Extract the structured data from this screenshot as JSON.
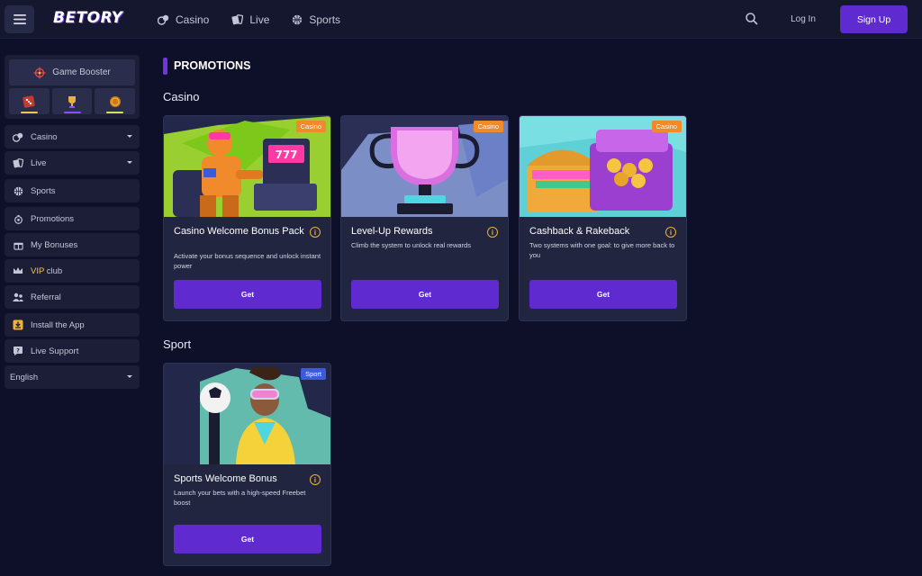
{
  "header": {
    "logo": "BETORY",
    "nav": [
      {
        "label": "Casino",
        "icon": "casino-chips-icon"
      },
      {
        "label": "Live",
        "icon": "live-cards-icon"
      },
      {
        "label": "Sports",
        "icon": "basketball-icon"
      }
    ],
    "login_label": "Log In",
    "signup_label": "Sign Up"
  },
  "sidebar": {
    "booster_label": "Game Booster",
    "booster_tiles": [
      {
        "icon": "dice-icon",
        "bar_color": "#f5c542"
      },
      {
        "icon": "trophy-icon",
        "bar_color": "#8a4dff"
      },
      {
        "icon": "coin-icon",
        "bar_color": "#d7e34a"
      }
    ],
    "items": [
      {
        "label": "Casino",
        "icon": "casino-chips-icon",
        "has_caret": true
      },
      {
        "label": "Live",
        "icon": "live-cards-icon",
        "has_caret": true
      },
      {
        "label": "Sports",
        "icon": "basketball-icon"
      },
      {
        "label": "Promotions",
        "icon": "gift-icon"
      },
      {
        "label": "My Bonuses",
        "icon": "gift-box-icon"
      },
      {
        "label": "VIP club",
        "icon": "crown-icon",
        "vip_prefix": "VIP",
        "vip_rest": " club"
      },
      {
        "label": "Referral",
        "icon": "referral-users-icon"
      },
      {
        "label": "Install the App",
        "icon": "download-icon"
      },
      {
        "label": "Live Support",
        "icon": "chat-icon"
      }
    ],
    "language": "English"
  },
  "main": {
    "title": "PROMOTIONS",
    "sections": [
      {
        "title": "Casino",
        "cards": [
          {
            "badge": "Casino",
            "title": "Casino Welcome Bonus Pack",
            "desc": "Activate your bonus sequence and unlock instant power",
            "button": "Get"
          },
          {
            "badge": "Casino",
            "title": "Level-Up Rewards",
            "desc": "Climb the system to unlock real rewards",
            "button": "Get"
          },
          {
            "badge": "Casino",
            "title": "Cashback & Rakeback",
            "desc": "Two systems with one goal: to give more back to you",
            "button": "Get"
          }
        ]
      },
      {
        "title": "Sport",
        "cards": [
          {
            "badge": "Sport",
            "title": "Sports Welcome Bonus",
            "desc": "Launch your bets with a high-speed Freebet boost",
            "button": "Get"
          }
        ]
      }
    ],
    "info_glyph": "i"
  },
  "colors": {
    "background": "#0e1029",
    "header": "#15172f",
    "panel": "#1b1e36",
    "card": "#22253f",
    "accent": "#5f2ad0",
    "casino_badge": "#f08a2b",
    "sport_badge": "#3b5bdb",
    "info": "#f0b232"
  }
}
